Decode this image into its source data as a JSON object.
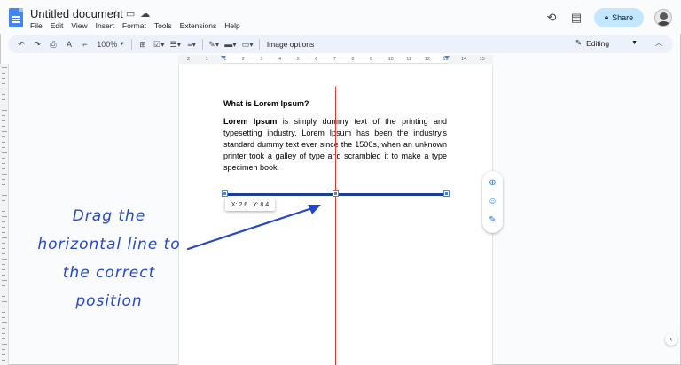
{
  "doc": {
    "title": "Untitled document"
  },
  "menu": [
    "File",
    "Edit",
    "View",
    "Insert",
    "Format",
    "Tools",
    "Extensions",
    "Help"
  ],
  "share": {
    "label": "Share"
  },
  "toolbar": {
    "zoom": "100%",
    "image_options": "Image options",
    "mode": "Editing"
  },
  "ruler": {
    "labels": [
      "2",
      "1",
      "1",
      "2",
      "3",
      "4",
      "5",
      "6",
      "7",
      "8",
      "9",
      "10",
      "11",
      "12",
      "13",
      "14",
      "15"
    ]
  },
  "content": {
    "heading": "What is Lorem Ipsum?",
    "para_bold": "Lorem Ipsum",
    "para_rest": " is simply dummy text of the printing and typesetting industry. Lorem Ipsum has been the industry's standard dummy text ever since the 1500s, when an unknown printer took a galley of type and scrambled it to make a type specimen book."
  },
  "tooltip": {
    "x": "X: 2.6",
    "y": "Y: 8.4"
  },
  "annotation": [
    "Drag the",
    "horizontal line to",
    "the correct",
    "position"
  ],
  "colors": {
    "accent": "#1a73e8",
    "guide": "#e53935",
    "line": "#1a3f8f",
    "annotation": "#2747c9",
    "share_bg": "#c2e7ff"
  },
  "icons": [
    "docs-logo-icon",
    "star-icon",
    "folder-icon",
    "cloud-icon",
    "history-icon",
    "comment-icon",
    "lock-icon",
    "undo-icon",
    "redo-icon",
    "print-icon",
    "spellcheck-icon",
    "paint-format-icon",
    "add-comment-icon",
    "emoji-icon",
    "suggest-edit-icon",
    "pencil-icon",
    "collapse-icon"
  ]
}
